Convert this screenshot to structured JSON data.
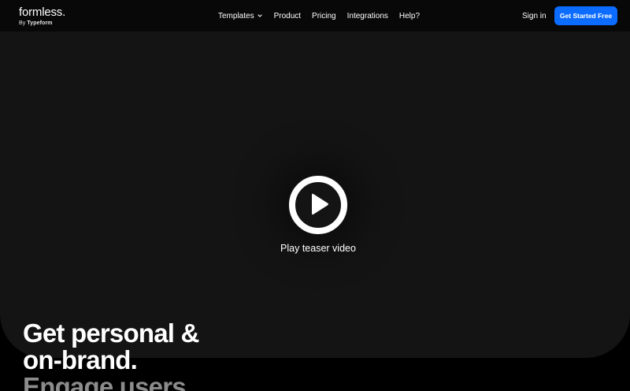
{
  "header": {
    "logo_main": "formless.",
    "logo_by": "By",
    "logo_brand": "Typeform",
    "nav": [
      {
        "label": "Templates",
        "has_dropdown": true
      },
      {
        "label": "Product"
      },
      {
        "label": "Pricing"
      },
      {
        "label": "Integrations"
      },
      {
        "label": "Help?"
      }
    ],
    "sign_in": "Sign in",
    "cta": "Get Started Free"
  },
  "hero": {
    "play_label": "Play teaser video",
    "headline": [
      "Get personal &",
      "on-brand.",
      "Engage users"
    ]
  },
  "icons": {
    "play": "play-circle-icon",
    "dropdown": "chevron-down-icon"
  },
  "colors": {
    "cta_bg": "#0b6cff",
    "panel_bg": "#141414",
    "page_bg": "#000000"
  }
}
